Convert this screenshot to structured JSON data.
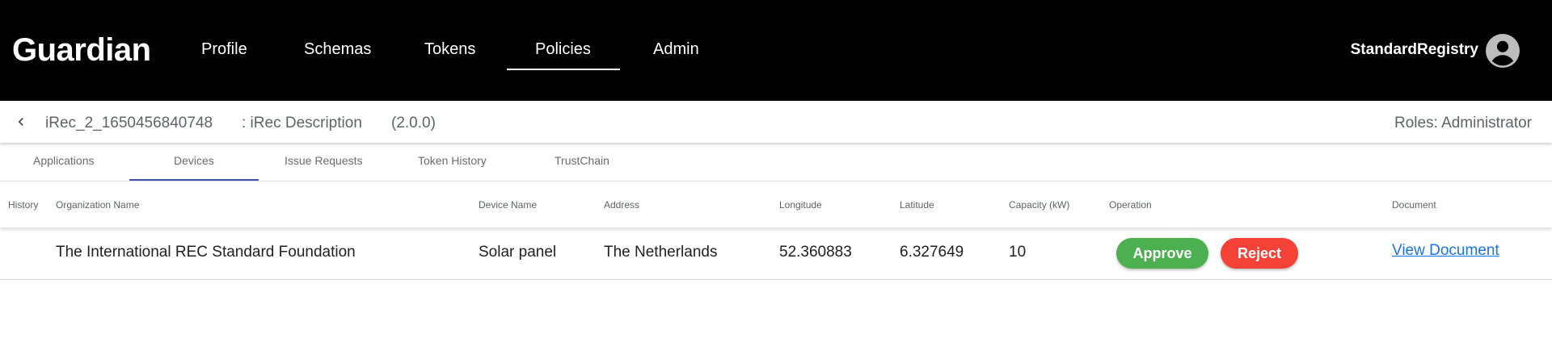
{
  "header": {
    "logo": "Guardian",
    "nav": [
      {
        "label": "Profile"
      },
      {
        "label": "Schemas"
      },
      {
        "label": "Tokens"
      },
      {
        "label": "Policies",
        "active": true
      },
      {
        "label": "Admin"
      }
    ],
    "user": "StandardRegistry",
    "avatar_icon": "account-circle-icon"
  },
  "policy": {
    "back_icon": "chevron-left-icon",
    "name": "iRec_2_1650456840748",
    "description": ": iRec Description",
    "version": "(2.0.0)",
    "roles": "Roles: Administrator"
  },
  "tabs": [
    {
      "label": "Applications"
    },
    {
      "label": "Devices",
      "active": true
    },
    {
      "label": "Issue Requests"
    },
    {
      "label": "Token History"
    },
    {
      "label": "TrustChain"
    }
  ],
  "table": {
    "columns": [
      "History",
      "Organization Name",
      "Device Name",
      "Address",
      "Longitude",
      "Latitude",
      "Capacity (kW)",
      "Operation",
      "Document"
    ],
    "rows": [
      {
        "history": "",
        "organization": "The International REC Standard Foundation",
        "device": "Solar panel",
        "address": "The Netherlands",
        "longitude": "52.360883",
        "latitude": "6.327649",
        "capacity": "10",
        "approve_label": "Approve",
        "reject_label": "Reject",
        "document_link": "View Document"
      }
    ]
  },
  "colors": {
    "header_bg": "#000000",
    "approve": "#4caf50",
    "reject": "#f44336",
    "link": "#1a73e8",
    "tab_indicator": "#3f51b5"
  }
}
